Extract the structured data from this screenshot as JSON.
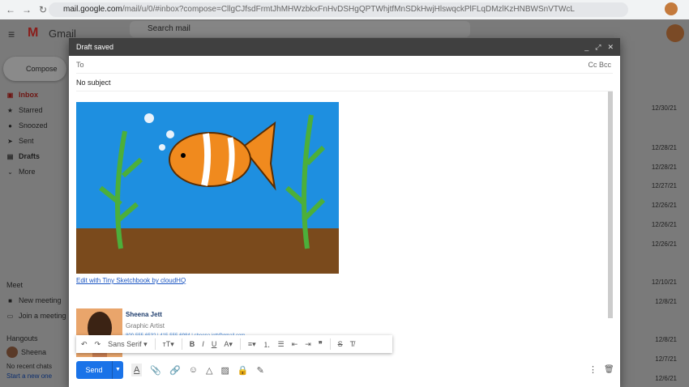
{
  "browser": {
    "url_host": "mail.google.com",
    "url_path": "/mail/u/0/#inbox?compose=CllgCJfsdFrmtJhMHWzbkxFnHvDSHgQPTWhjtfMnSDkHwjHlswqckPlFLqDMzlKzHNBWSnVTWcL"
  },
  "gmail": {
    "logo": "Gmail",
    "search_placeholder": "Search mail",
    "compose": "Compose",
    "nav": [
      {
        "label": "Inbox",
        "icon": "inbox-icon"
      },
      {
        "label": "Starred",
        "icon": "star-icon"
      },
      {
        "label": "Snoozed",
        "icon": "clock-icon"
      },
      {
        "label": "Sent",
        "icon": "send-icon"
      },
      {
        "label": "Drafts",
        "icon": "draft-icon"
      },
      {
        "label": "More",
        "icon": "chevron-down-icon"
      }
    ],
    "meet": {
      "heading": "Meet",
      "new_meeting": "New meeting",
      "join_meeting": "Join a meeting"
    },
    "hangouts": {
      "heading": "Hangouts",
      "user": "Sheena",
      "no_recent": "No recent chats",
      "start_new": "Start a new one"
    },
    "dates": [
      "12/30/21",
      "12/28/21",
      "12/28/21",
      "12/27/21",
      "12/26/21",
      "12/26/21",
      "12/26/21",
      "12/10/21",
      "12/8/21",
      "12/8/21",
      "12/7/21",
      "12/6/21"
    ]
  },
  "compose": {
    "header": "Draft saved",
    "to_label": "To",
    "cc_bcc": "Cc Bcc",
    "subject": "No subject",
    "edit_link": "Edit with Tiny Sketchbook by cloudHQ",
    "signature": {
      "name": "Sheena Jett",
      "title": "Graphic Artist",
      "contact": "800-555-6532 | 415-555-6984 | sheena.jett@gmail.com"
    },
    "font": "Sans Serif",
    "send": "Send"
  },
  "colors": {
    "send": "#1a73e8",
    "header": "#404040",
    "water": "#1e8fe0",
    "ground": "#7a4a1c",
    "fish": "#f08a1e"
  }
}
